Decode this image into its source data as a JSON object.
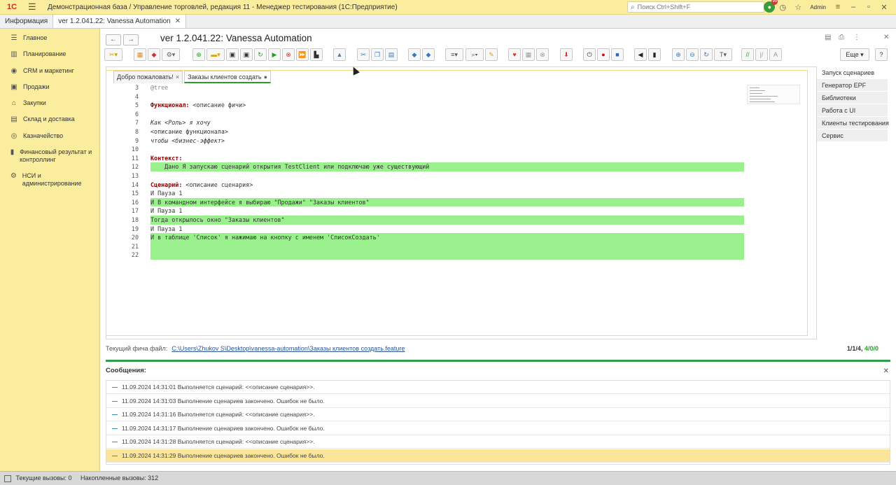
{
  "titlebar": {
    "logo": "1С",
    "title": "Демонстрационная база / Управление торговлей, редакция 11  - Менеджер тестирования (1С:Предприятие)",
    "search_placeholder": "Поиск Ctrl+Shift+F",
    "notification_count": "99",
    "user": "Admin"
  },
  "tabs": [
    {
      "label": "Информация"
    },
    {
      "label": "ver 1.2.041.22: Vanessa Automation"
    }
  ],
  "sidebar": {
    "items": [
      {
        "label": "Главное",
        "icon": "menu-icon"
      },
      {
        "label": "Планирование",
        "icon": "chart-icon"
      },
      {
        "label": "CRM и маркетинг",
        "icon": "crm-icon"
      },
      {
        "label": "Продажи",
        "icon": "sales-icon"
      },
      {
        "label": "Закупки",
        "icon": "purchase-icon"
      },
      {
        "label": "Склад и доставка",
        "icon": "warehouse-icon"
      },
      {
        "label": "Казначейство",
        "icon": "treasury-icon"
      },
      {
        "label": "Финансовый результат и контроллинг",
        "icon": "finance-icon"
      },
      {
        "label": "НСИ и администрирование",
        "icon": "settings-icon"
      }
    ]
  },
  "window": {
    "title": "ver 1.2.041.22: Vanessa Automation",
    "more_label": "Еще",
    "help_label": "?"
  },
  "doc_tabs": [
    {
      "label": "Добро пожаловать!",
      "closable": "×"
    },
    {
      "label": "Заказы клиентов создать",
      "closable": "●"
    }
  ],
  "editor": {
    "lines": [
      {
        "n": "3",
        "text": "@tree"
      },
      {
        "n": "4",
        "text": ""
      },
      {
        "n": "5",
        "kw": "Функционал:",
        "text": " <описание фичи>"
      },
      {
        "n": "6",
        "text": ""
      },
      {
        "n": "7",
        "text": "Как <Роль> я хочу"
      },
      {
        "n": "8",
        "text": "<описание функционала>"
      },
      {
        "n": "9",
        "text": "чтобы <бизнес-эффект>"
      },
      {
        "n": "10",
        "text": ""
      },
      {
        "n": "11",
        "kw": "Контекст:",
        "text": ""
      },
      {
        "n": "12",
        "text": "    Дано Я запускаю сценарий открытия TestClient или подключаю уже существующий"
      },
      {
        "n": "13",
        "text": ""
      },
      {
        "n": "14",
        "kw": "Сценарий:",
        "text": " <описание сценария>"
      },
      {
        "n": "15",
        "text": "И Пауза 1"
      },
      {
        "n": "16",
        "text": "И В командном интерфейсе я выбираю \"Продажи\" \"Заказы клиентов\""
      },
      {
        "n": "17",
        "text": "И Пауза 1"
      },
      {
        "n": "18",
        "text": "Тогда открылось окно \"Заказы клиентов\""
      },
      {
        "n": "19",
        "text": "И Пауза 1"
      },
      {
        "n": "20",
        "text": "И в таблице 'Список' я нажимаю на кнопку с именем 'СписокСоздать'"
      },
      {
        "n": "21",
        "text": ""
      },
      {
        "n": "22",
        "text": ""
      }
    ]
  },
  "right_panel": {
    "items": [
      "Запуск сценариев",
      "Генератор EPF",
      "Библиотеки",
      "Работа с UI",
      "Клиенты тестирования",
      "Сервис"
    ]
  },
  "file": {
    "label": "Текущий фича файл:",
    "path": "C:\\Users\\Zhukov S\\Desktop\\vanessa-automation\\Заказы клиентов создать.feature",
    "counter_a": "1/1/4,",
    "counter_b": "4/0/0"
  },
  "messages": {
    "title": "Сообщения:",
    "rows": [
      "11.09.2024 14:31:01 Выполняется сценарий: <<описание сценария>>.",
      "11.09.2024 14:31:03 Выполнение сценариев закончено. Ошибок не было.",
      "11.09.2024 14:31:16 Выполняется сценарий: <<описание сценария>>.",
      "11.09.2024 14:31:17 Выполнение сценариев закончено. Ошибок не было.",
      "11.09.2024 14:31:28 Выполняется сценарий: <<описание сценария>>.",
      "11.09.2024 14:31:29 Выполнение сценариев закончено. Ошибок не было."
    ]
  },
  "statusbar": {
    "current_calls": "Текущие вызовы: 0",
    "accumulated_calls": "Накопленные вызовы: 312"
  },
  "colors": {
    "accent_yellow": "#fbed9e",
    "highlight_green": "#9af08c",
    "selected_row": "#fbe59a",
    "progress_green": "#2e9d4e"
  }
}
